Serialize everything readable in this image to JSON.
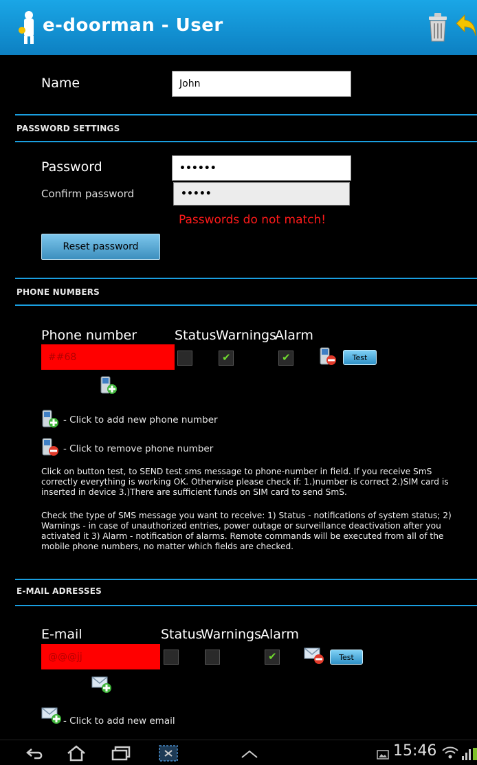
{
  "app": {
    "title": "e-doorman - User",
    "colors": {
      "accent": "#1a9fe0",
      "error": "#ff0000",
      "check": "#6fd82e"
    }
  },
  "toolbar": {
    "delete_icon": "trash-icon",
    "back_icon": "undo-arrow-icon"
  },
  "name": {
    "label": "Name",
    "value": "John"
  },
  "password_section": {
    "heading": "PASSWORD SETTINGS",
    "password_label": "Password",
    "password_value": "••••••",
    "confirm_label": "Confirm password",
    "confirm_value": "•••••",
    "error": "Passwords do not match!",
    "reset_button": "Reset password"
  },
  "phone_section": {
    "heading": "PHONE NUMBERS",
    "col_number": "Phone number",
    "col_status": "Status",
    "col_warnings": "Warnings",
    "col_alarm": "Alarm",
    "row": {
      "value": "##68",
      "status": false,
      "warnings": true,
      "alarm": true,
      "test": "Test"
    },
    "add_hint": "- Click to add new phone number",
    "remove_hint": "- Click to remove phone number",
    "help1": "Click on button test, to SEND test sms message to phone-number in field. If you receive SmS correctly everything is working OK. Otherwise please check if: 1.)number is correct 2.)SIM card is inserted in device 3.)There are sufficient funds on SIM card to send SmS.",
    "help2": "Check the type of SMS message you want to receive: 1) Status - notifications of system status; 2) Warnings - in case of unauthorized entries, power outage or surveillance deactivation after you activated it 3) Alarm - notification of alarms. Remote commands will be executed from all of the mobile phone numbers, no matter which fields are checked."
  },
  "email_section": {
    "heading": "E-MAIL ADRESSES",
    "col_email": "E-mail",
    "col_status": "Status",
    "col_warnings": "Warnings",
    "col_alarm": "Alarm",
    "row": {
      "value": "@@@jj",
      "status": false,
      "warnings": false,
      "alarm": true,
      "test": "Test"
    },
    "add_hint": "- Click to add new email"
  },
  "statusbar": {
    "time": "15:46"
  }
}
